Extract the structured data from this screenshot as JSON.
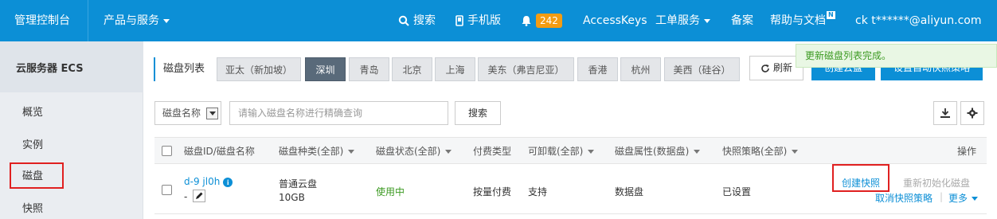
{
  "topbar": {
    "console": "管理控制台",
    "products": "产品与服务",
    "search": "搜索",
    "mobile": "手机版",
    "notification_count": "242",
    "accesskeys": "AccessKeys",
    "tickets": "工单服务",
    "record": "备案",
    "help": "帮助与文档",
    "help_badge": "N",
    "account": "ck    t******@aliyun.com"
  },
  "sidebar": {
    "title": "云服务器 ECS",
    "items": [
      {
        "label": "概览"
      },
      {
        "label": "实例"
      },
      {
        "label": "磁盘"
      },
      {
        "label": "快照"
      }
    ]
  },
  "main": {
    "list_title": "磁盘列表",
    "regions": [
      {
        "label": "亚太（新加坡）"
      },
      {
        "label": "深圳"
      },
      {
        "label": "青岛"
      },
      {
        "label": "北京"
      },
      {
        "label": "上海"
      },
      {
        "label": "美东（弗吉尼亚）"
      },
      {
        "label": "香港"
      },
      {
        "label": "杭州"
      },
      {
        "label": "美西（硅谷）"
      }
    ],
    "refresh": "刷新",
    "create_disk": "创建云盘",
    "auto_snapshot": "设置自动快照策略",
    "toast": "更新磁盘列表完成。",
    "filter_select": "磁盘名称",
    "search_placeholder": "请输入磁盘名称进行精确查询",
    "search_button": "搜索"
  },
  "table": {
    "headers": {
      "disk_id": "磁盘ID/磁盘名称",
      "type": "磁盘种类(全部)",
      "status": "磁盘状态(全部)",
      "billing": "付费类型",
      "detachable": "可卸载(全部)",
      "attribute": "磁盘属性(数据盘)",
      "snapshot_policy": "快照策略(全部)",
      "actions": "操作"
    },
    "rows": [
      {
        "disk_id": "d-9    jl0h",
        "disk_name": "-",
        "type": "普通云盘",
        "size": "10GB",
        "status": "使用中",
        "billing": "按量付费",
        "detachable": "支持",
        "attribute": "数据盘",
        "snapshot_policy": "已设置",
        "action_create_snapshot": "创建快照",
        "action_reinit": "重新初始化磁盘",
        "action_cancel_policy": "取消快照策略",
        "action_more": "更多"
      }
    ]
  },
  "colors": {
    "topbar": "#0c8fd6",
    "highlight": "#e02020",
    "status_ok": "#3c9a22"
  }
}
